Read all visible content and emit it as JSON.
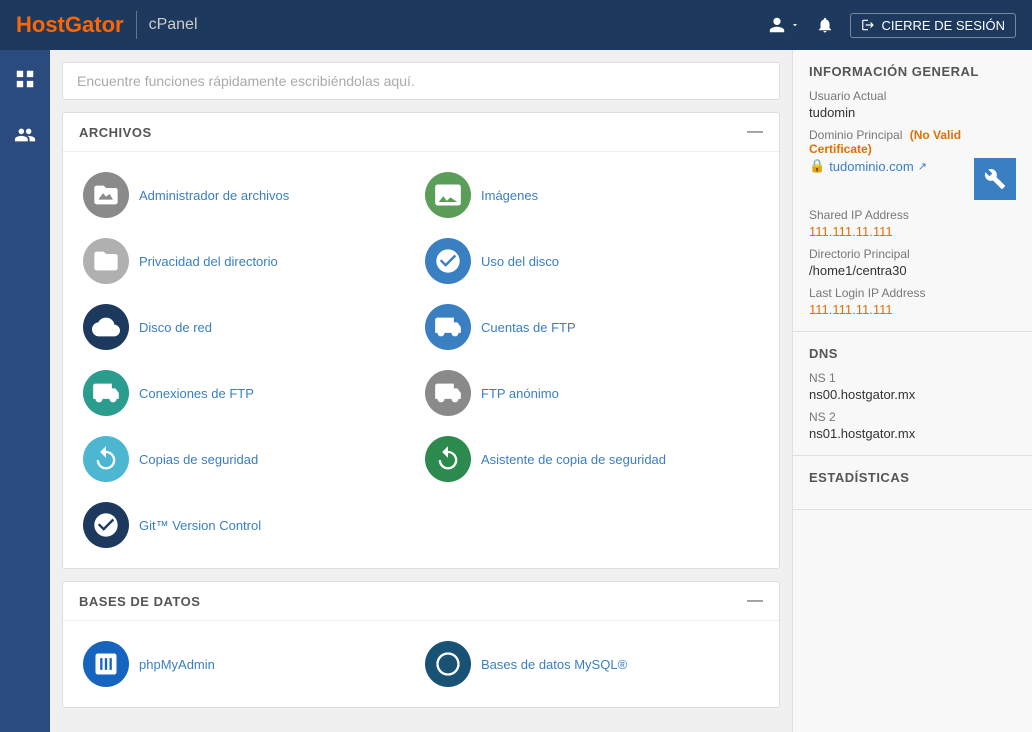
{
  "header": {
    "logo_hg": "Host",
    "logo_gator": "Gator",
    "cpanel_label": "cPanel",
    "user_icon": "👤",
    "bell_icon": "🔔",
    "logout_label": "CIERRE DE SESIÓN"
  },
  "search": {
    "placeholder": "Encuentre funciones rápidamente escribiéndolas aquí."
  },
  "sections": [
    {
      "id": "archivos",
      "title": "ARCHIVOS",
      "items": [
        {
          "id": "admin-archivos",
          "label": "Administrador de archivos",
          "icon": "🗄️",
          "color": "ic-gray"
        },
        {
          "id": "imagenes",
          "label": "Imágenes",
          "icon": "🖼️",
          "color": "ic-img"
        },
        {
          "id": "privacidad",
          "label": "Privacidad del directorio",
          "icon": "📁",
          "color": "ic-gray"
        },
        {
          "id": "uso-disco",
          "label": "Uso del disco",
          "icon": "💿",
          "color": "ic-blue"
        },
        {
          "id": "disco-red",
          "label": "Disco de red",
          "icon": "🌐",
          "color": "ic-navy"
        },
        {
          "id": "cuentas-ftp",
          "label": "Cuentas de FTP",
          "icon": "🚚",
          "color": "ic-blue"
        },
        {
          "id": "conexiones-ftp",
          "label": "Conexiones de FTP",
          "icon": "🚛",
          "color": "ic-teal"
        },
        {
          "id": "ftp-anonimo",
          "label": "FTP anónimo",
          "icon": "🚛",
          "color": "ic-gray"
        },
        {
          "id": "copias-seguridad",
          "label": "Copias de seguridad",
          "icon": "🔄",
          "color": "ic-cyan"
        },
        {
          "id": "asistente-copia",
          "label": "Asistente de copia de seguridad",
          "icon": "🔃",
          "color": "ic-green"
        },
        {
          "id": "git-version",
          "label": "Git™ Version Control",
          "icon": "⚙️",
          "color": "ic-navy"
        }
      ]
    },
    {
      "id": "bases-datos",
      "title": "BASES DE DATOS",
      "items": [
        {
          "id": "phpmyadmin",
          "label": "phpMyAdmin",
          "icon": "🗃️",
          "color": "ic-db"
        },
        {
          "id": "mysql",
          "label": "Bases de datos MySQL®",
          "icon": "🗄️",
          "color": "ic-darkblue"
        }
      ]
    }
  ],
  "right_panel": {
    "info_title": "INFORMACIÓN GENERAL",
    "usuario_label": "Usuario Actual",
    "usuario_value": "tudomin",
    "dominio_label": "Dominio Principal",
    "dominio_warning": "(No Valid Certificate)",
    "dominio_lock": "🔒",
    "dominio_link": "tudominio.com",
    "dominio_ext_icon": "↗",
    "shared_ip_label": "Shared IP Address",
    "shared_ip_value": "111.111.11.111",
    "directorio_label": "Directorio Principal",
    "directorio_value": "/home1/centra30",
    "last_login_label": "Last Login IP Address",
    "last_login_value": "111.111.11.111",
    "dns_title": "DNS",
    "ns1_label": "NS 1",
    "ns1_value": "ns00.hostgator.mx",
    "ns2_label": "NS 2",
    "ns2_value": "ns01.hostgator.mx",
    "estadisticas_title": "ESTADÍSTICAS"
  }
}
